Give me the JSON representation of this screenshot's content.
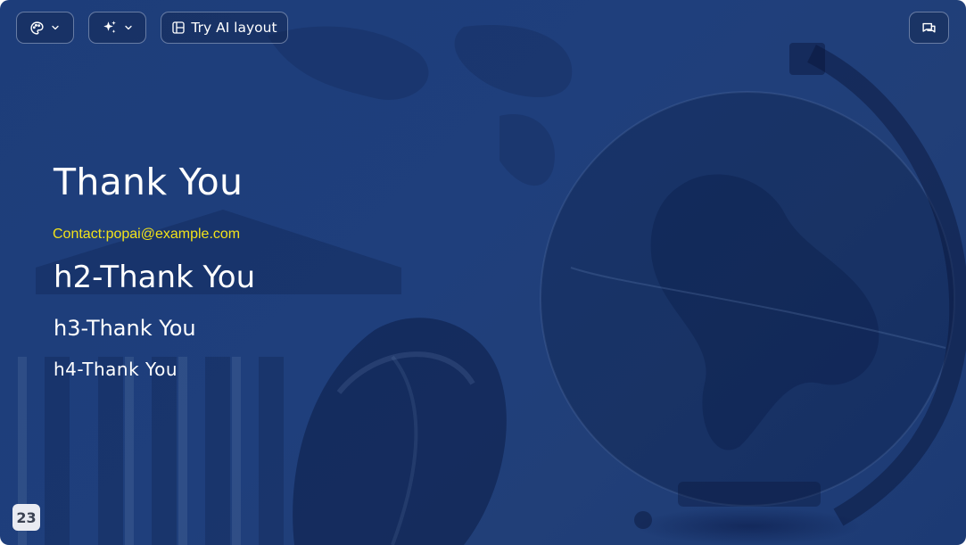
{
  "toolbar": {
    "theme_icon": "palette-icon",
    "magic_icon": "sparkles-icon",
    "dropdown_icon": "chevron-down-icon",
    "layout_icon": "layout-icon",
    "layout_label": "Try AI layout",
    "chat_icon": "chat-icon"
  },
  "slide": {
    "title": "Thank You",
    "contact": "Contact:popai@example.com",
    "heading2": "h2-Thank You",
    "heading3": "h3-Thank You",
    "heading4": "h4-Thank You",
    "page_number": "23"
  },
  "colors": {
    "background": "#1f3f7c",
    "text": "#ffffff",
    "contact": "#f2e21a",
    "badge_bg": "#e9ebf2"
  }
}
